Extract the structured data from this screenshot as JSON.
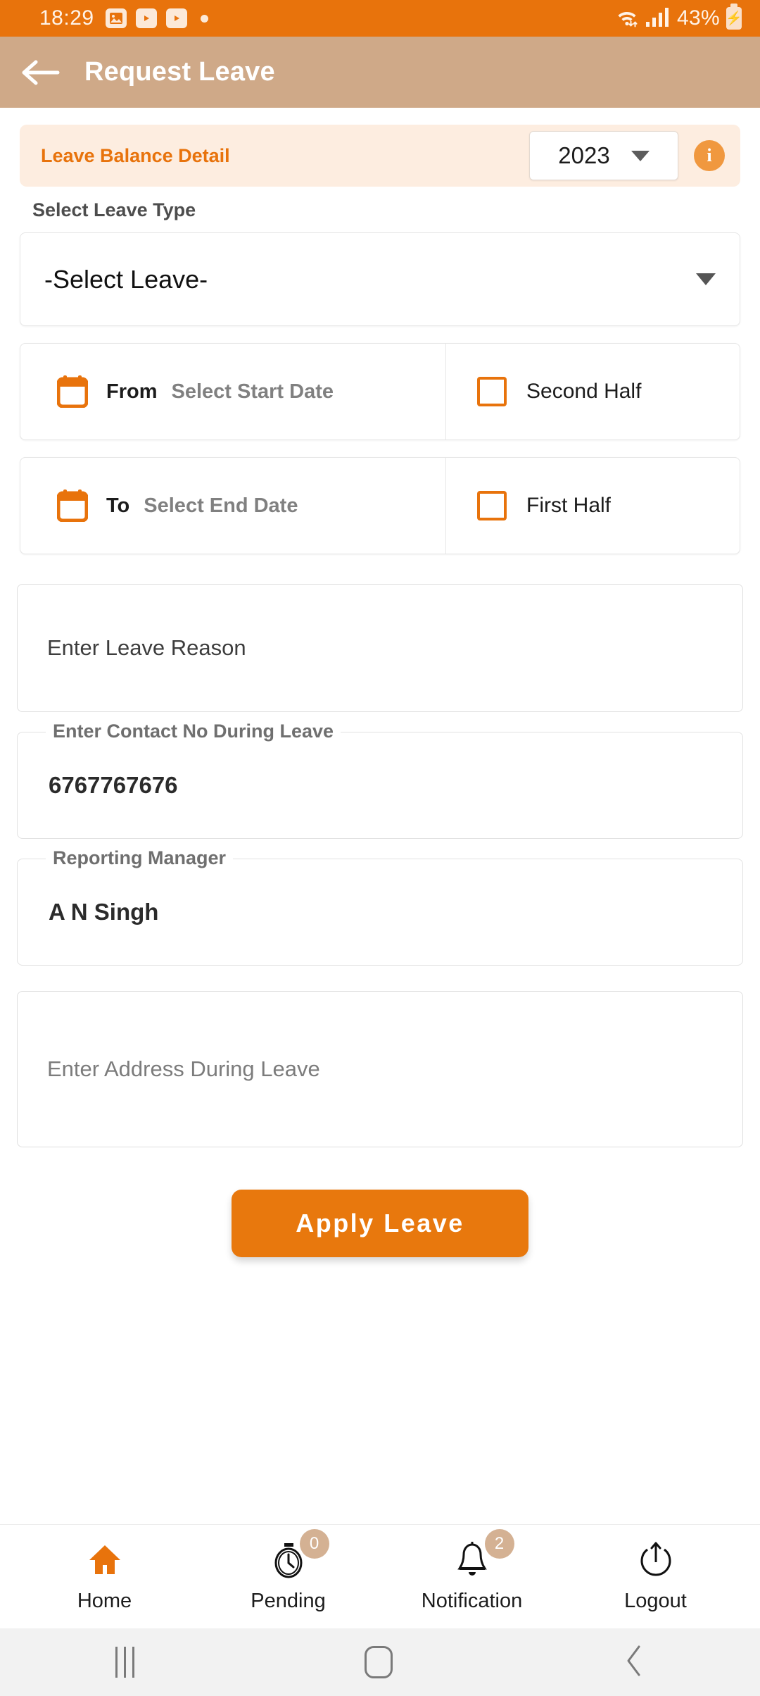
{
  "status_bar": {
    "time": "18:29",
    "icons": [
      "image-icon",
      "youtube-icon",
      "youtube-icon",
      "dot-icon"
    ],
    "wifi_icon": "wifi-icon",
    "signal_icon": "cellular-signal-icon",
    "battery_percent": "43%",
    "battery_icon": "battery-charging-icon"
  },
  "app_bar": {
    "back_icon": "back-arrow-icon",
    "title": "Request Leave"
  },
  "balance_banner": {
    "title": "Leave Balance Detail",
    "year_value": "2023",
    "year_dropdown_icon": "chevron-down-icon",
    "info_icon": "info-icon",
    "info_glyph": "i"
  },
  "leave_type": {
    "label": "Select Leave Type",
    "selected": "-Select Leave-",
    "dropdown_icon": "chevron-down-icon"
  },
  "from_row": {
    "calendar_icon": "calendar-icon",
    "keyword": "From",
    "placeholder": "Select Start Date",
    "checkbox_icon": "checkbox-unchecked-icon",
    "checkbox_label": "Second Half"
  },
  "to_row": {
    "calendar_icon": "calendar-icon",
    "keyword": "To",
    "placeholder": "Select End Date",
    "checkbox_icon": "checkbox-unchecked-icon",
    "checkbox_label": "First Half"
  },
  "reason": {
    "placeholder": "Enter Leave Reason"
  },
  "contact": {
    "label": "Enter Contact No During Leave",
    "value": "6767767676"
  },
  "manager": {
    "label": "Reporting Manager",
    "value": "A N Singh"
  },
  "address": {
    "placeholder": "Enter Address During Leave"
  },
  "apply_button": {
    "label": "Apply Leave"
  },
  "bottom_nav": [
    {
      "label": "Home",
      "icon": "home-icon",
      "badge": null
    },
    {
      "label": "Pending",
      "icon": "stopwatch-icon",
      "badge": "0"
    },
    {
      "label": "Notification",
      "icon": "bell-icon",
      "badge": "2"
    },
    {
      "label": "Logout",
      "icon": "power-icon",
      "badge": null
    }
  ],
  "system_nav": {
    "recents_icon": "recents-icon",
    "home_icon": "home-square-icon",
    "back_icon": "back-chevron-icon"
  },
  "colors": {
    "status_bar": "#E8730C",
    "app_bar": "#CFA988",
    "accent": "#E8730C",
    "banner_bg": "#FDEDE0",
    "badge_bg": "#D4B193"
  }
}
